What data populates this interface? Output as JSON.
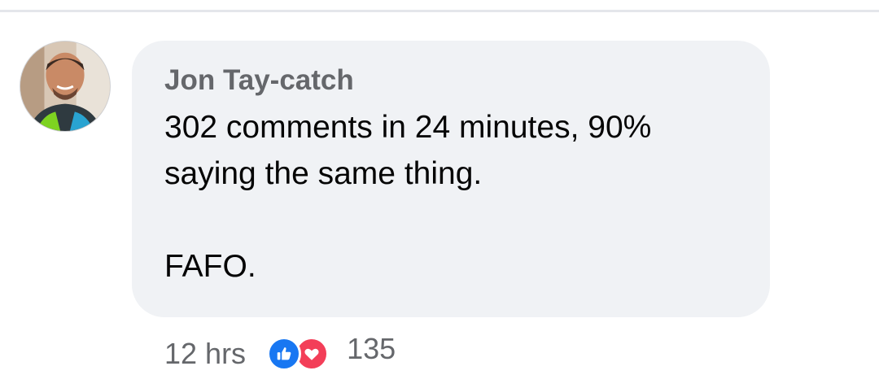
{
  "comment": {
    "author": "Jon Tay-catch",
    "text": "302 comments in 24 minutes, 90%\nsaying the same thing.\n\nFAFO.",
    "timestamp": "12 hrs",
    "reactions": {
      "icons": [
        "like-icon",
        "love-icon"
      ],
      "count": "135"
    }
  },
  "colors": {
    "bubble": "#f0f2f5",
    "author": "#65676b",
    "text": "#050505",
    "like": "#1877f2",
    "love": "#f33e58"
  }
}
